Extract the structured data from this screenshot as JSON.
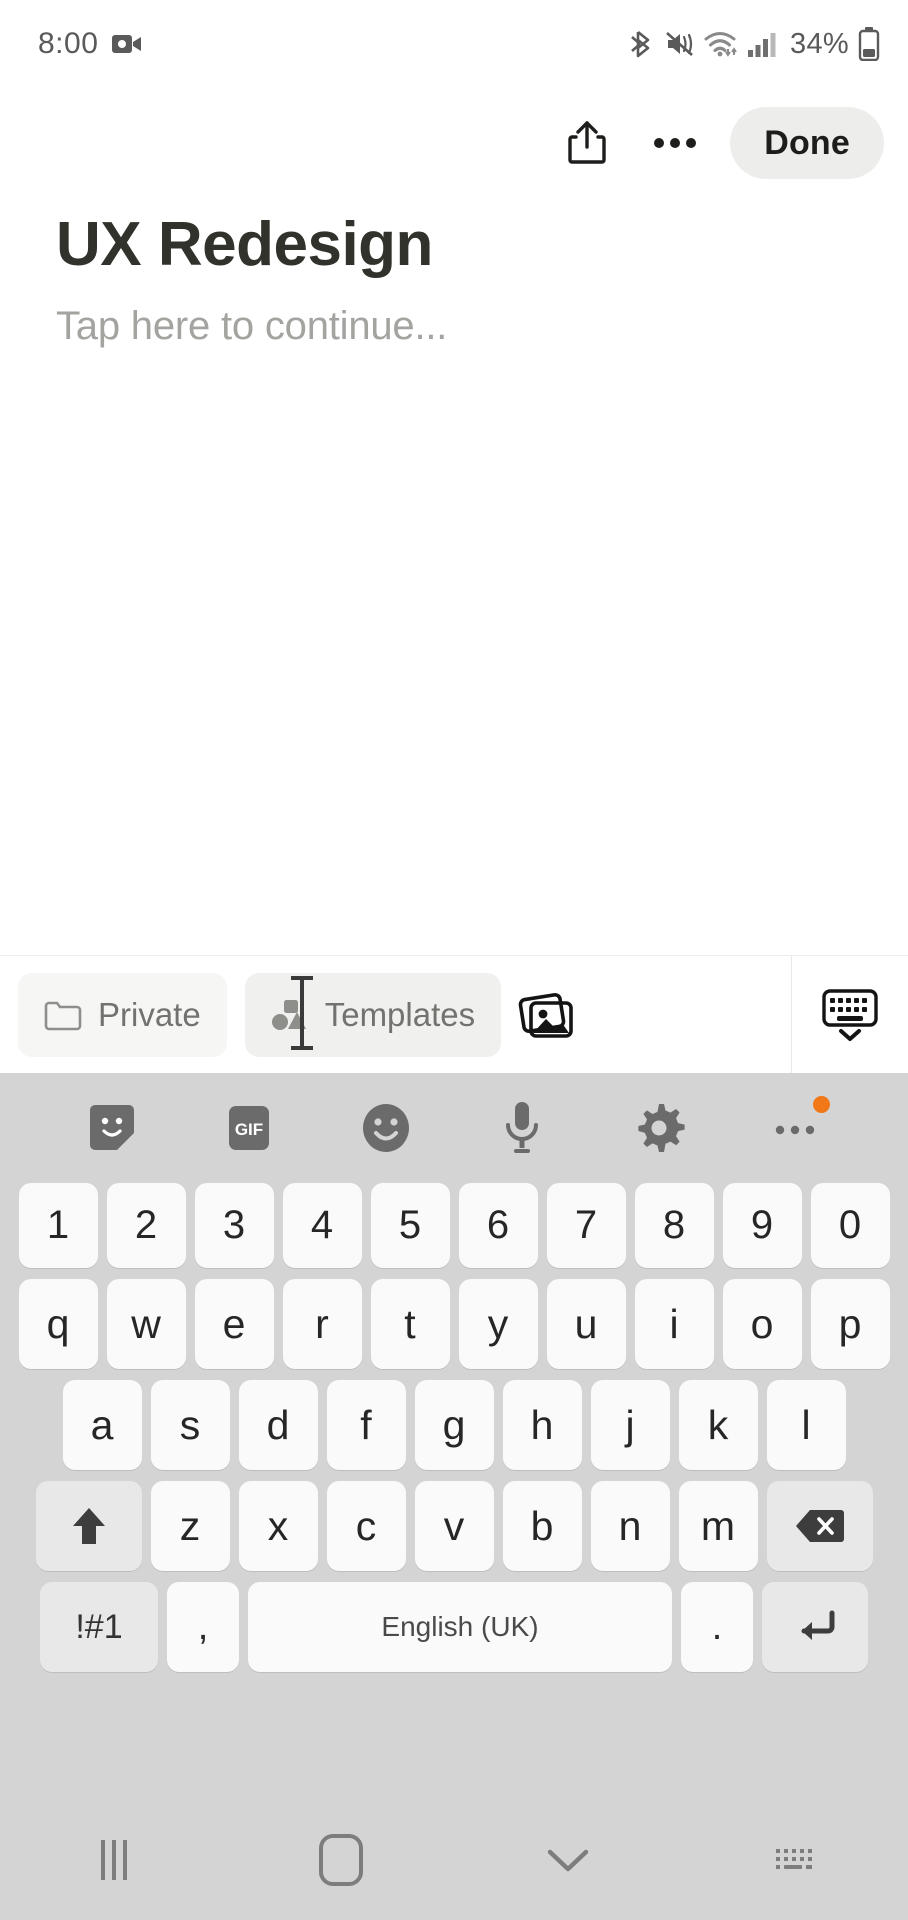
{
  "status_bar": {
    "time": "8:00",
    "battery_percent": "34%",
    "icons": [
      "video-recording-icon",
      "bluetooth-icon",
      "mute-icon",
      "wifi-icon",
      "cellular-signal-icon",
      "battery-icon"
    ]
  },
  "action_bar": {
    "share_icon": "share-icon",
    "more_icon": "more-options-icon",
    "done_label": "Done"
  },
  "note": {
    "title": "UX Redesign",
    "placeholder": "Tap here to continue..."
  },
  "toolbar": {
    "private_label": "Private",
    "templates_label": "Templates",
    "gallery_icon": "gallery-icon",
    "hide_keyboard_icon": "hide-keyboard-icon"
  },
  "keyboard": {
    "tools": [
      {
        "name": "sticker-icon",
        "label": ""
      },
      {
        "name": "gif-icon",
        "label": "GIF"
      },
      {
        "name": "emoji-icon",
        "label": ""
      },
      {
        "name": "microphone-icon",
        "label": ""
      },
      {
        "name": "settings-gear-icon",
        "label": ""
      },
      {
        "name": "keyboard-more-icon",
        "label": ""
      }
    ],
    "more_badge_color": "#f07818",
    "rows": {
      "numbers": [
        "1",
        "2",
        "3",
        "4",
        "5",
        "6",
        "7",
        "8",
        "9",
        "0"
      ],
      "top": [
        "q",
        "w",
        "e",
        "r",
        "t",
        "y",
        "u",
        "i",
        "o",
        "p"
      ],
      "home": [
        "a",
        "s",
        "d",
        "f",
        "g",
        "h",
        "j",
        "k",
        "l"
      ],
      "bottom": [
        "z",
        "x",
        "c",
        "v",
        "b",
        "n",
        "m"
      ]
    },
    "shift_icon": "shift-icon",
    "backspace_icon": "backspace-icon",
    "symbols_label": "!#1",
    "comma_label": ",",
    "space_label": "English (UK)",
    "period_label": ".",
    "enter_icon": "enter-icon"
  },
  "nav_bar": {
    "recent_icon": "recent-apps-icon",
    "home_icon": "home-icon",
    "back_icon": "hide-keyboard-chevron-icon",
    "keyboard_switch_icon": "keyboard-switcher-icon"
  },
  "colors": {
    "accent_badge": "#f07818",
    "title_text": "#32322c",
    "placeholder_text": "#a3a3a0",
    "keyboard_bg": "#d4d4d4",
    "key_bg": "#fafafa"
  }
}
